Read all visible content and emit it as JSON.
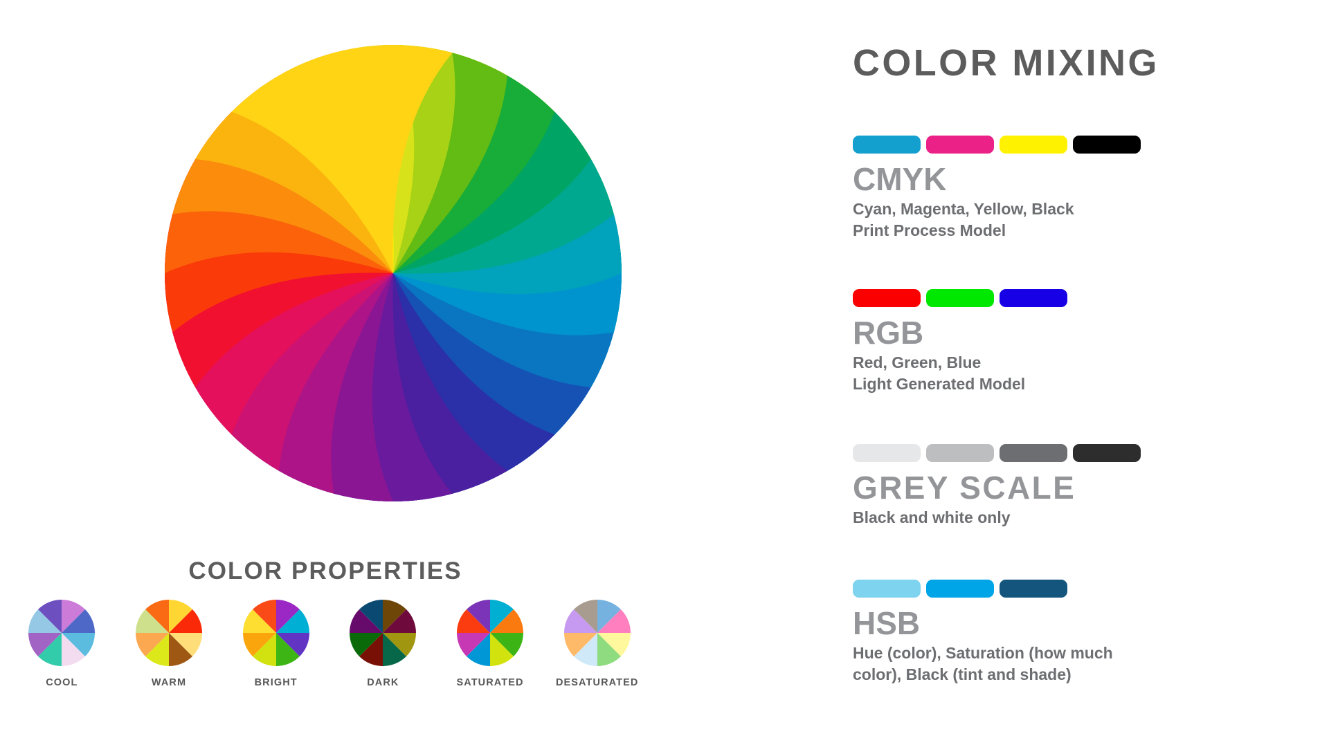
{
  "header": {
    "title": "COLOR MIXING"
  },
  "color_models": [
    {
      "id": "cmyk",
      "name": "CMYK",
      "spaced": false,
      "desc_lines": [
        "Cyan, Magenta, Yellow, Black",
        "Print Process Model"
      ],
      "swatches": [
        {
          "name": "cyan-swatch",
          "color": "#14A0CE"
        },
        {
          "name": "magenta-swatch",
          "color": "#EC2188"
        },
        {
          "name": "yellow-swatch",
          "color": "#FFF200"
        },
        {
          "name": "black-swatch",
          "color": "#000000"
        }
      ]
    },
    {
      "id": "rgb",
      "name": "RGB",
      "spaced": false,
      "desc_lines": [
        "Red, Green, Blue",
        "Light Generated Model"
      ],
      "swatches": [
        {
          "name": "red-swatch",
          "color": "#FB0000"
        },
        {
          "name": "green-swatch",
          "color": "#00E800"
        },
        {
          "name": "blue-swatch",
          "color": "#1800E6"
        }
      ]
    },
    {
      "id": "grey",
      "name": "GREY SCALE",
      "spaced": true,
      "desc_lines": [
        "Black and white only"
      ],
      "swatches": [
        {
          "name": "grey-light-swatch",
          "color": "#E6E7E8"
        },
        {
          "name": "grey-mid-light-swatch",
          "color": "#BCBEC0"
        },
        {
          "name": "grey-mid-dark-swatch",
          "color": "#6D6E71"
        },
        {
          "name": "grey-dark-swatch",
          "color": "#2D2D2D"
        }
      ]
    },
    {
      "id": "hsb",
      "name": "HSB",
      "spaced": false,
      "desc_lines": [
        "Hue (color), Saturation (how much",
        "color), Black (tint and shade)"
      ],
      "swatches": [
        {
          "name": "hsb-tint-swatch",
          "color": "#7ED3EE"
        },
        {
          "name": "hsb-hue-swatch",
          "color": "#00A5E8"
        },
        {
          "name": "hsb-shade-swatch",
          "color": "#13557D"
        }
      ]
    }
  ],
  "color_properties": {
    "title": "COLOR PROPERTIES",
    "items": [
      {
        "label": "COOL",
        "segments": [
          "#CC7CD8",
          "#4E68C8",
          "#5CBCE0",
          "#F4DCF0",
          "#33CCAA",
          "#A163C4",
          "#95C8E5",
          "#6E4FC0"
        ]
      },
      {
        "label": "WARM",
        "segments": [
          "#FFD632",
          "#FA2A08",
          "#FFDE7A",
          "#9E5814",
          "#DCE81A",
          "#FBA850",
          "#CEE08C",
          "#FA6A14"
        ]
      },
      {
        "label": "BRIGHT",
        "segments": [
          "#9B28C4",
          "#00AFD4",
          "#6134C4",
          "#3DB515",
          "#D2E210",
          "#FBA50C",
          "#FFDE32",
          "#FA4A18"
        ]
      },
      {
        "label": "DARK",
        "segments": [
          "#6E4608",
          "#6E0A3C",
          "#A09610",
          "#066849",
          "#781006",
          "#0A6A0A",
          "#660A6C",
          "#0A4A72"
        ]
      },
      {
        "label": "SATURATED",
        "segments": [
          "#00AFD2",
          "#FA7A10",
          "#3CB415",
          "#D2E20F",
          "#0097D6",
          "#C638B4",
          "#FA3C10",
          "#7B34B8"
        ]
      },
      {
        "label": "DESATURATED",
        "segments": [
          "#75B2DF",
          "#FF7FBF",
          "#FFF89C",
          "#8FDB80",
          "#CFE9F9",
          "#FFBA69",
          "#C79AF2",
          "#A89C90"
        ]
      }
    ]
  },
  "main_wheel": {
    "name": "color-wheel-spiral",
    "petal_count": 24,
    "hue_start": 60,
    "colors": [
      "#FFF200",
      "#D7E21A",
      "#A8D215",
      "#62BC14",
      "#18AC38",
      "#00A464",
      "#00A890",
      "#00A2BC",
      "#0094CE",
      "#0A76C2",
      "#1552B4",
      "#2B2FA8",
      "#4A1FA0",
      "#6A1A9C",
      "#8A1694",
      "#AC1488",
      "#CC1272",
      "#E4105C",
      "#F21030",
      "#FA3A08",
      "#FB620A",
      "#FB8C0C",
      "#FBB40E",
      "#FED415"
    ]
  }
}
